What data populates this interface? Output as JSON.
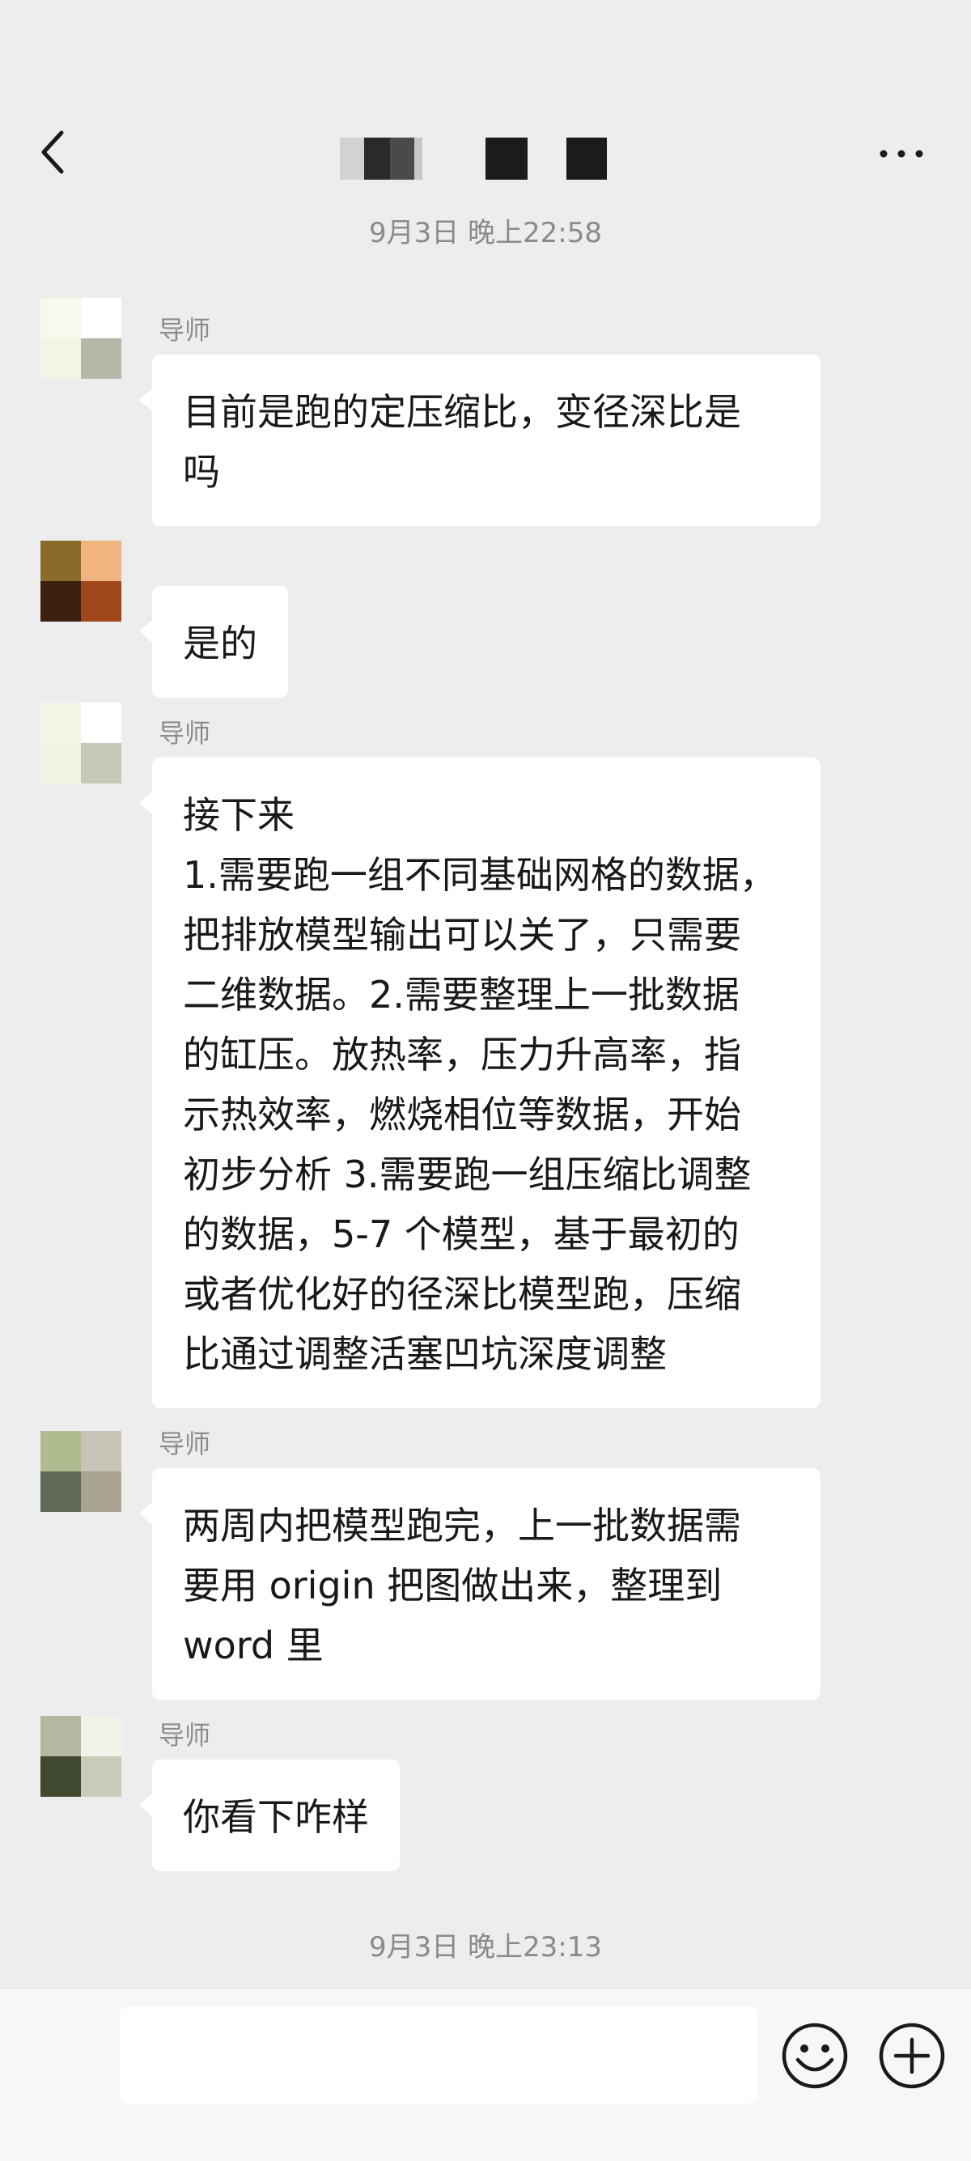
{
  "header": {
    "back_icon": "chevron-left-icon",
    "title_censored": true,
    "more_icon": "more-horizontal-icon"
  },
  "timestamps": {
    "first": "9月3日 晚上22:58",
    "second": "9月3日 晚上23:13"
  },
  "messages": [
    {
      "sender": "导师",
      "lines": [
        "目前是跑的定压缩比，变径深比是",
        "吗"
      ],
      "avatar_colors": [
        "#f8f8ee",
        "#ffffff",
        "#f4f4e6",
        "#b4b8a8"
      ]
    },
    {
      "sender": "",
      "lines": [
        "是的"
      ],
      "avatar_colors": [
        "#8c6a2c",
        "#f0b480",
        "#3c2010",
        "#a0481c"
      ]
    },
    {
      "sender": "导师",
      "lines": [
        "接下来",
        "1.需要跑一组不同基础网格的数据，",
        "把排放模型输出可以关了，只需要",
        "二维数据。2.需要整理上一批数据",
        "的缸压。放热率，压力升高率，指",
        "示热效率，燃烧相位等数据，开始",
        "初步分析 3.需要跑一组压缩比调整",
        "的数据，5-7 个模型，基于最初的",
        "或者优化好的径深比模型跑，压缩",
        "比通过调整活塞凹坑深度调整"
      ],
      "avatar_colors": [
        "#f4f4e6",
        "#ffffff",
        "#f2f2e4",
        "#c4c8b8"
      ]
    },
    {
      "sender": "导师",
      "lines": [
        "两周内把模型跑完，上一批数据需",
        "要用 origin 把图做出来，整理到",
        "word 里"
      ],
      "avatar_colors": [
        "#b0bc90",
        "#c8c4b8",
        "#606858",
        "#a8a490"
      ]
    },
    {
      "sender": "导师",
      "lines": [
        "你看下咋样"
      ],
      "avatar_colors": [
        "#b4b8a0",
        "#f2f2ea",
        "#404830",
        "#c8ccb8"
      ]
    }
  ],
  "input_bar": {
    "text": "",
    "emoji_icon": "emoji-smile-icon",
    "plus_icon": "plus-circle-icon"
  },
  "colors": {
    "background": "#ededed",
    "bubble": "#ffffff",
    "timestamp": "#8a8a8a"
  }
}
